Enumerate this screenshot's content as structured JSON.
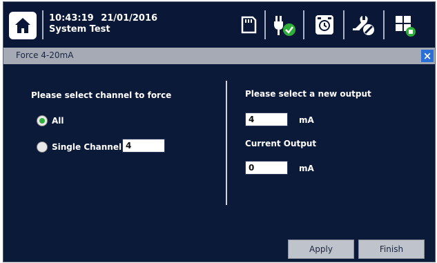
{
  "header": {
    "time": "10:43:19",
    "date": "21/01/2016",
    "mode": "System Test",
    "icons": [
      "home-icon",
      "sd-card-icon",
      "power-plug-icon",
      "alarm-clock-icon",
      "tools-icon",
      "grid-apps-icon"
    ]
  },
  "dialog": {
    "title": "Force 4-20mA",
    "left": {
      "heading": "Please select channel to force",
      "option_all": "All",
      "option_single": "Single Channel",
      "single_channel_value": "4",
      "selected": "All"
    },
    "right": {
      "heading": "Please select a new output",
      "new_output_value": "4",
      "new_output_unit": "mA",
      "current_heading": "Current Output",
      "current_output_value": "0",
      "current_output_unit": "mA"
    },
    "apply_label": "Apply",
    "finish_label": "Finish"
  },
  "colors": {
    "background": "#0c1a3a",
    "header_bar": "#a6aab4",
    "close_button": "#2a6fd6",
    "radio_selected": "#2fae3a",
    "status_ok": "#2fae3a"
  }
}
